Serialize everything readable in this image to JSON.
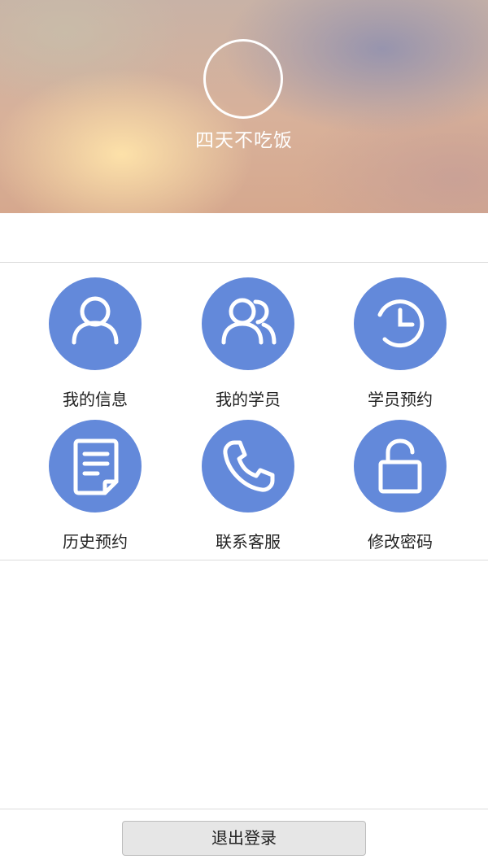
{
  "profile": {
    "username": "四天不吃饭"
  },
  "menu": {
    "items": [
      {
        "label": "我的信息",
        "icon": "user-icon"
      },
      {
        "label": "我的学员",
        "icon": "users-icon"
      },
      {
        "label": "学员预约",
        "icon": "clock-icon"
      },
      {
        "label": "历史预约",
        "icon": "document-icon"
      },
      {
        "label": "联系客服",
        "icon": "phone-icon"
      },
      {
        "label": "修改密码",
        "icon": "unlock-icon"
      }
    ]
  },
  "footer": {
    "logout_label": "退出登录"
  },
  "colors": {
    "accent": "#6389da",
    "icon_fg": "#ffffff"
  }
}
